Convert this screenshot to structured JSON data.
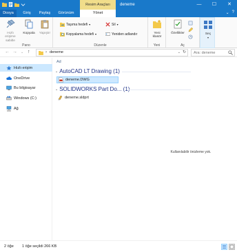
{
  "title_bar": {
    "context_tab_header": "Resim Araçları",
    "window_title": "deneme",
    "minimize": "—",
    "maximize": "☐",
    "close": "✕"
  },
  "tabs": {
    "file": "Dosya",
    "home": "Giriş",
    "share": "Paylaş",
    "view": "Görünüm",
    "manage": "Yönet",
    "expand": "⌄",
    "help": "?"
  },
  "ribbon": {
    "clipboard": {
      "label": "Pano",
      "pin_quick_access": "Hızlı erişime sabitle",
      "copy": "Kopyala",
      "paste": "Yapıştır"
    },
    "organize": {
      "label": "Düzenle",
      "move_to": "Taşıma hedefi",
      "copy_to": "Kopyalama hedefi",
      "delete": "Sil",
      "rename": "Yeniden adlandır"
    },
    "new": {
      "label": "Yeni",
      "new_folder": "Yeni klasör"
    },
    "open": {
      "label": "Aç",
      "properties": "Özellikler"
    },
    "select": {
      "select": "Seç"
    }
  },
  "address_bar": {
    "back": "←",
    "forward": "→",
    "recent": "⌄",
    "up": "↑",
    "separator": "›",
    "path": "deneme",
    "dropdown": "⌄",
    "refresh": "↻",
    "search_placeholder": "Ara: deneme"
  },
  "nav_pane": {
    "items": [
      {
        "label": "Hızlı erişim",
        "icon": "star-icon",
        "selected": true
      },
      {
        "label": "OneDrive",
        "icon": "cloud-icon",
        "selected": false
      },
      {
        "label": "Bu bilgisayar",
        "icon": "computer-icon",
        "selected": false
      },
      {
        "label": "Windows (C:)",
        "icon": "drive-icon",
        "selected": false
      },
      {
        "label": "Ağ",
        "icon": "network-icon",
        "selected": false
      }
    ]
  },
  "content": {
    "column_header": "Ad",
    "groups": [
      {
        "name": "AutoCAD LT Drawing (1)",
        "files": [
          {
            "name": "deneme.DWG",
            "selected": true
          }
        ]
      },
      {
        "name": "SOLIDWORKS Part Do... (1)",
        "files": [
          {
            "name": "deneme.sldprt",
            "selected": false
          }
        ]
      }
    ],
    "preview_message": "Kullanılabilir önizleme yok."
  },
  "status_bar": {
    "item_count": "2 öğe",
    "selection": "1 öğe seçildi  266 KB"
  },
  "colors": {
    "accent": "#1979ca",
    "context_tab": "#f1dd8a",
    "selection_bg": "#cce8ff",
    "group_text": "#1e3287"
  }
}
